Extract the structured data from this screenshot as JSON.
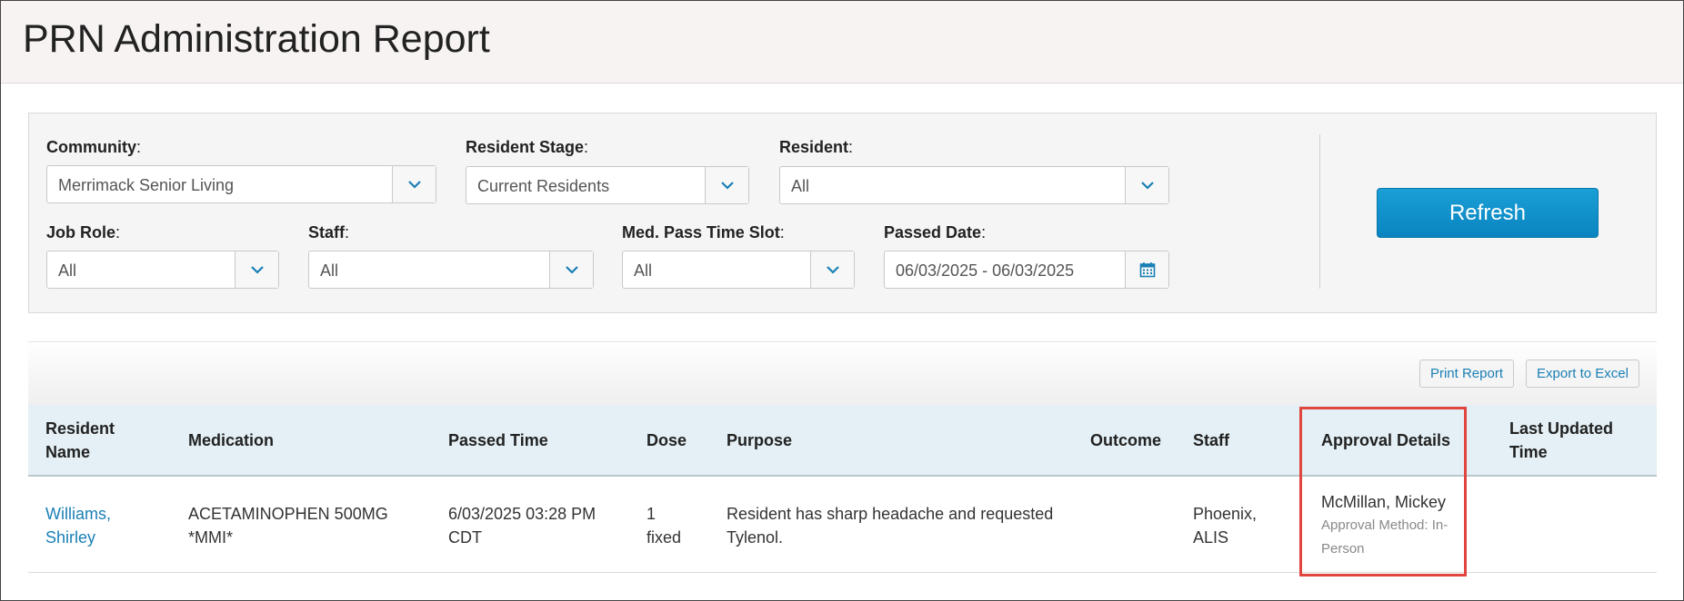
{
  "page": {
    "title": "PRN Administration Report"
  },
  "filters": {
    "community": {
      "label": "Community",
      "value": "Merrimack Senior Living"
    },
    "resident_stage": {
      "label": "Resident Stage",
      "value": "Current Residents"
    },
    "resident": {
      "label": "Resident",
      "value": "All"
    },
    "job_role": {
      "label": "Job Role",
      "value": "All"
    },
    "staff": {
      "label": "Staff",
      "value": "All"
    },
    "time_slot": {
      "label": "Med. Pass Time Slot",
      "value": "All"
    },
    "passed_date": {
      "label": "Passed Date",
      "value": "06/03/2025 - 06/03/2025"
    },
    "colon": ":"
  },
  "actions": {
    "refresh": "Refresh",
    "print": "Print Report",
    "export": "Export to Excel"
  },
  "table": {
    "headers": {
      "resident_name_1": "Resident",
      "resident_name_2": "Name",
      "medication": "Medication",
      "passed_time": "Passed Time",
      "dose": "Dose",
      "purpose": "Purpose",
      "outcome": "Outcome",
      "staff": "Staff",
      "approval": "Approval Details",
      "last_updated_1": "Last Updated",
      "last_updated_2": "Time"
    },
    "rows": [
      {
        "resident_1": "Williams,",
        "resident_2": "Shirley",
        "medication_1": "ACETAMINOPHEN 500MG",
        "medication_2": "*MMI*",
        "passed_time_1": "6/03/2025 03:28 PM",
        "passed_time_2": "CDT",
        "dose_1": "1",
        "dose_2": "fixed",
        "purpose_1": "Resident has sharp headache and requested",
        "purpose_2": "Tylenol.",
        "outcome": "",
        "staff_1": "Phoenix,",
        "staff_2": "ALIS",
        "approver": "McMillan, Mickey",
        "approval_method_1": "Approval Method: In-",
        "approval_method_2": "Person",
        "last_updated": ""
      }
    ]
  },
  "colors": {
    "accent": "#1a7fb5",
    "refresh_bg": "#0a84c0",
    "highlight": "#e0453e",
    "header_bg": "#e4f0f5"
  },
  "icons": {
    "caret": "chevron-down-icon",
    "calendar": "calendar-icon"
  }
}
